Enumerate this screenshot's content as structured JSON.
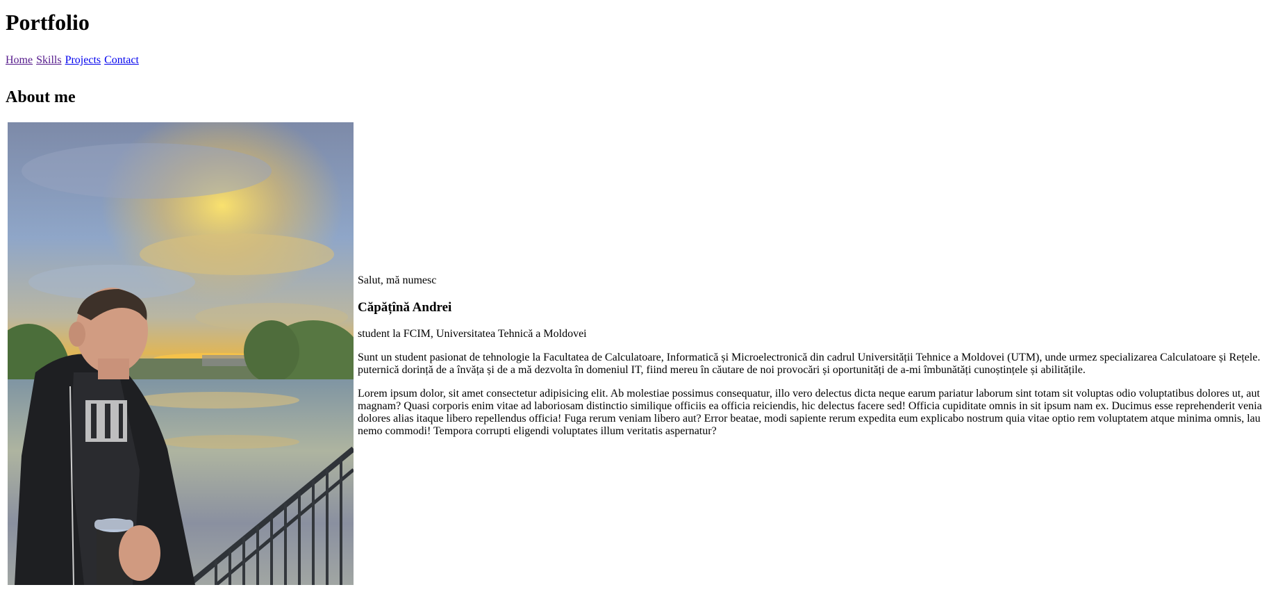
{
  "header": {
    "title": "Portfolio"
  },
  "nav": {
    "items": [
      {
        "label": "Home"
      },
      {
        "label": "Skills"
      },
      {
        "label": "Projects"
      },
      {
        "label": "Contact"
      }
    ]
  },
  "about": {
    "heading": "About me",
    "greeting": "Salut, mă numesc",
    "name": "Căpățînă Andrei",
    "role": "student la FCIM, Universitatea Tehnică a Moldovei",
    "bio": [
      "Sunt un student pasionat de tehnologie la Facultatea de Calculatoare, Informatică și Microelectronică din cadrul Universității Tehnice a Moldovei (UTM), unde urmez specializarea Calculatoare și Rețele.",
      "puternică dorință de a învăța și de a mă dezvolta în domeniul IT, fiind mereu în căutare de noi provocări și oportunități de a-mi îmbunătăți cunoștințele și abilitățile."
    ],
    "lorem": [
      "Lorem ipsum dolor, sit amet consectetur adipisicing elit. Ab molestiae possimus consequatur, illo vero delectus dicta neque earum pariatur laborum sint totam sit voluptas odio voluptatibus dolores ut, aut",
      "magnam? Quasi corporis enim vitae ad laboriosam distinctio similique officiis ea officia reiciendis, hic delectus facere sed! Officia cupiditate omnis in sit ipsum nam ex. Ducimus esse reprehenderit venia",
      "dolores alias itaque libero repellendus officia! Fuga rerum veniam libero aut? Error beatae, modi sapiente rerum expedita eum explicabo nostrum quia vitae optio rem voluptatem atque minima omnis, lau",
      "nemo commodi! Tempora corrupti eligendi voluptates illum veritatis aspernatur?"
    ]
  }
}
